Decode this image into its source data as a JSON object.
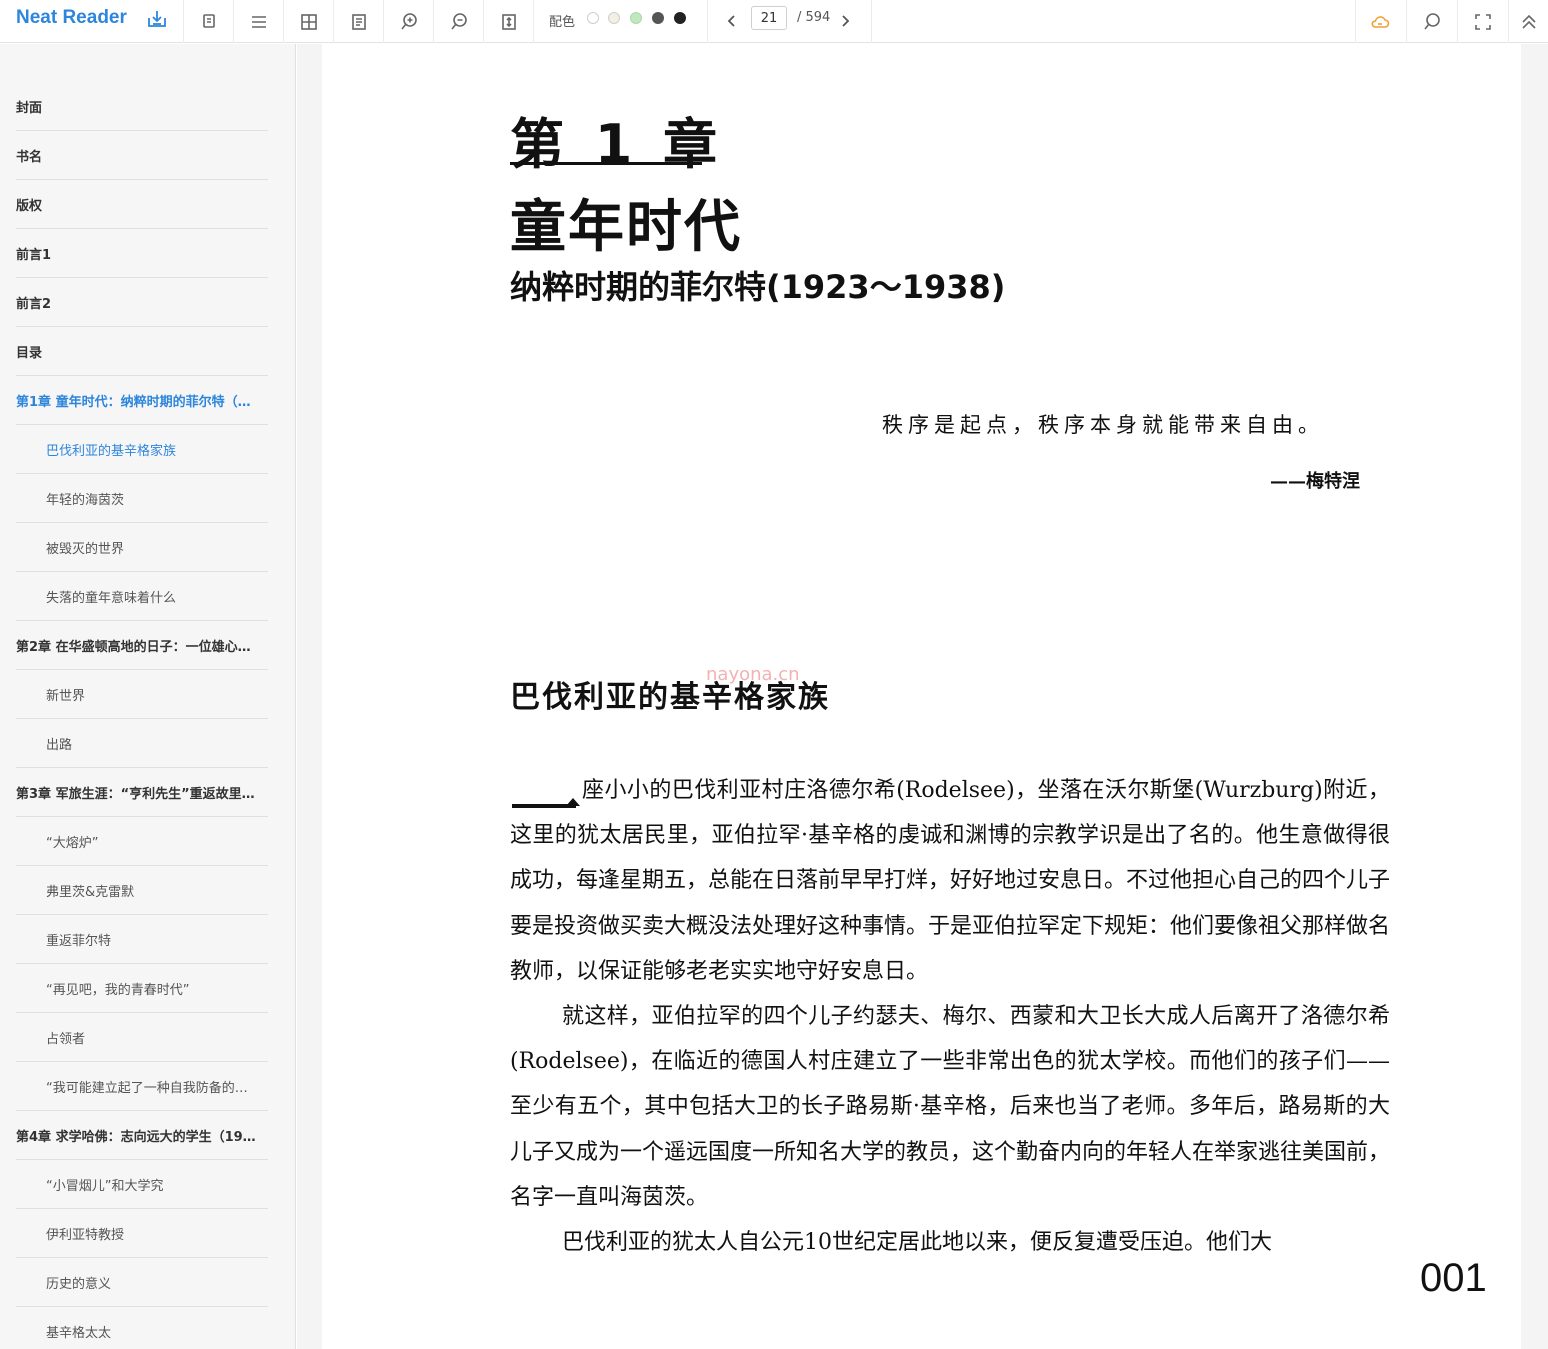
{
  "app": {
    "brand": "Neat Reader"
  },
  "toolbar": {
    "theme_label": "配色",
    "theme_colors": [
      "#ffffff",
      "#f2efe4",
      "#bfe8bf",
      "#555555",
      "#222222"
    ],
    "page_current": "21",
    "page_total": "/ 594",
    "icons": [
      "export-icon",
      "copy-icon",
      "menu-icon",
      "grid-icon",
      "document-icon",
      "zoom-in-icon",
      "zoom-out-icon",
      "fit-height-icon",
      "cloud-icon",
      "search-icon",
      "fullscreen-icon",
      "collapse-up-icon"
    ],
    "cloud_color": "#f0a030"
  },
  "toc": [
    {
      "label": "封面",
      "level": 1,
      "active": false
    },
    {
      "label": "书名",
      "level": 1,
      "active": false
    },
    {
      "label": "版权",
      "level": 1,
      "active": false
    },
    {
      "label": "前言1",
      "level": 1,
      "active": false
    },
    {
      "label": "前言2",
      "level": 1,
      "active": false
    },
    {
      "label": "目录",
      "level": 1,
      "active": false
    },
    {
      "label": "第1章 童年时代：纳粹时期的菲尔特（…",
      "level": 1,
      "active": true
    },
    {
      "label": "巴伐利亚的基辛格家族",
      "level": 2,
      "active": true
    },
    {
      "label": "年轻的海茵茨",
      "level": 2,
      "active": false
    },
    {
      "label": "被毁灭的世界",
      "level": 2,
      "active": false
    },
    {
      "label": "失落的童年意味着什么",
      "level": 2,
      "active": false
    },
    {
      "label": "第2章 在华盛顿高地的日子：一位雄心…",
      "level": 1,
      "active": false
    },
    {
      "label": "新世界",
      "level": 2,
      "active": false
    },
    {
      "label": "出路",
      "level": 2,
      "active": false
    },
    {
      "label": "第3章 军旅生涯：“亨利先生”重返故里…",
      "level": 1,
      "active": false
    },
    {
      "label": "“大熔炉”",
      "level": 2,
      "active": false
    },
    {
      "label": "弗里茨&克雷默",
      "level": 2,
      "active": false
    },
    {
      "label": "重返菲尔特",
      "level": 2,
      "active": false
    },
    {
      "label": "“再见吧，我的青春时代”",
      "level": 2,
      "active": false
    },
    {
      "label": "占领者",
      "level": 2,
      "active": false
    },
    {
      "label": "“我可能建立起了一种自我防备的…",
      "level": 2,
      "active": false
    },
    {
      "label": "第4章 求学哈佛：志向远大的学生（19…",
      "level": 1,
      "active": false
    },
    {
      "label": "“小冒烟儿”和大学究",
      "level": 2,
      "active": false
    },
    {
      "label": "伊利亚特教授",
      "level": 2,
      "active": false
    },
    {
      "label": "历史的意义",
      "level": 2,
      "active": false
    },
    {
      "label": "基辛格太太",
      "level": 2,
      "active": false
    }
  ],
  "page": {
    "chapter_label": "第 1 章",
    "chapter_title": "童年时代",
    "chapter_subtitle": "纳粹时期的菲尔特(1923～1938)",
    "epigraph": "秩序是起点，秩序本身就能带来自由。",
    "epigraph_author": "——梅特涅",
    "watermark": "nayona.cn",
    "section_title": "巴伐利亚的基辛格家族",
    "paragraphs": [
      "座小小的巴伐利亚村庄洛德尔希(Rodelsee)，坐落在沃尔斯堡(Wurzburg)附近，这里的犹太居民里，亚伯拉罕·基辛格的虔诚和渊博的宗教学识是出了名的。他生意做得很成功，每逢星期五，总能在日落前早早打烊，好好地过安息日。不过他担心自己的四个儿子要是投资做买卖大概没法处理好这种事情。于是亚伯拉罕定下规矩：他们要像祖父那样做名教师，以保证能够老老实实地守好安息日。",
      "就这样，亚伯拉罕的四个儿子约瑟夫、梅尔、西蒙和大卫长大成人后离开了洛德尔希(Rodelsee)，在临近的德国人村庄建立了一些非常出色的犹太学校。而他们的孩子们——至少有五个，其中包括大卫的长子路易斯·基辛格，后来也当了老师。多年后，路易斯的大儿子又成为一个遥远国度一所知名大学的教员，这个勤奋内向的年轻人在举家逃往美国前，名字一直叫海茵茨。",
      "巴伐利亚的犹太人自公元10世纪定居此地以来，便反复遭受压迫。他们大"
    ],
    "page_number": "001"
  }
}
